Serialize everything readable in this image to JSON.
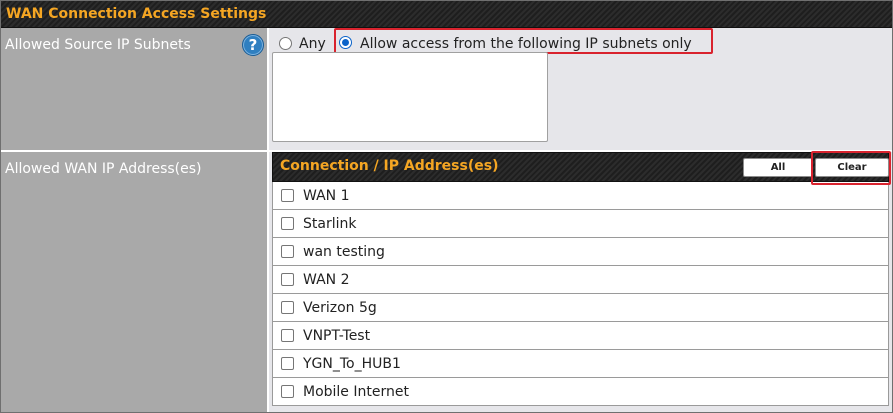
{
  "section": {
    "title": "WAN Connection Access Settings"
  },
  "source_subnets": {
    "label": "Allowed Source IP Subnets",
    "help_icon": "question-circle-icon",
    "options": [
      {
        "label": "Any",
        "selected": false
      },
      {
        "label": "Allow access from the following IP subnets only",
        "selected": true
      }
    ],
    "subnets_text": ""
  },
  "wan_ips": {
    "label": "Allowed WAN IP Address(es)",
    "table_header": "Connection / IP Address(es)",
    "all_button": "All",
    "clear_button": "Clear",
    "connections": [
      {
        "label": "WAN 1",
        "checked": false
      },
      {
        "label": "Starlink",
        "checked": false
      },
      {
        "label": "wan testing",
        "checked": false
      },
      {
        "label": "WAN 2",
        "checked": false
      },
      {
        "label": "Verizon 5g",
        "checked": false
      },
      {
        "label": "VNPT-Test",
        "checked": false
      },
      {
        "label": "YGN_To_HUB1",
        "checked": false
      },
      {
        "label": "Mobile Internet",
        "checked": false
      }
    ]
  },
  "colors": {
    "header_text": "#f5a623",
    "label_bg": "#a9a9a9",
    "value_bg": "#e6e6ea",
    "highlight": "#d9232e",
    "radio_accent": "#0b63c9",
    "help_icon": "#2f7fc0"
  }
}
